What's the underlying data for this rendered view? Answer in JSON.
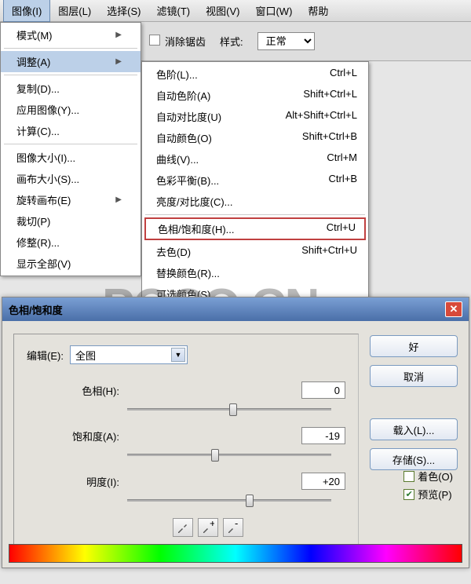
{
  "menubar": {
    "items": [
      {
        "label": "图像(I)",
        "hot": "I",
        "active": true
      },
      {
        "label": "图层(L)"
      },
      {
        "label": "选择(S)"
      },
      {
        "label": "滤镜(T)"
      },
      {
        "label": "视图(V)"
      },
      {
        "label": "窗口(W)"
      },
      {
        "label": "帮助"
      }
    ]
  },
  "optionsbar": {
    "antialias": "消除锯齿",
    "style_label": "样式:",
    "style_value": "正常"
  },
  "image_menu": {
    "items": [
      {
        "label": "模式(M)",
        "arrow": true
      },
      {
        "sep": true
      },
      {
        "label": "调整(A)",
        "arrow": true,
        "hl": true
      },
      {
        "sep": true
      },
      {
        "label": "复制(D)..."
      },
      {
        "label": "应用图像(Y)..."
      },
      {
        "label": "计算(C)..."
      },
      {
        "sep": true
      },
      {
        "label": "图像大小(I)..."
      },
      {
        "label": "画布大小(S)..."
      },
      {
        "label": "旋转画布(E)",
        "arrow": true
      },
      {
        "label": "裁切(P)"
      },
      {
        "label": "修整(R)..."
      },
      {
        "label": "显示全部(V)"
      }
    ]
  },
  "adjust_submenu": {
    "items": [
      {
        "label": "色阶(L)...",
        "sc": "Ctrl+L"
      },
      {
        "label": "自动色阶(A)",
        "sc": "Shift+Ctrl+L"
      },
      {
        "label": "自动对比度(U)",
        "sc": "Alt+Shift+Ctrl+L"
      },
      {
        "label": "自动颜色(O)",
        "sc": "Shift+Ctrl+B"
      },
      {
        "label": "曲线(V)...",
        "sc": "Ctrl+M"
      },
      {
        "label": "色彩平衡(B)...",
        "sc": "Ctrl+B"
      },
      {
        "label": "亮度/对比度(C)...",
        "sc": ""
      },
      {
        "sep": true
      },
      {
        "label": "色相/饱和度(H)...",
        "sc": "Ctrl+U",
        "boxed": true
      },
      {
        "label": "去色(D)",
        "sc": "Shift+Ctrl+U"
      },
      {
        "label": "替换颜色(R)...",
        "sc": ""
      },
      {
        "label": "可选颜色(S)...",
        "sc": ""
      }
    ]
  },
  "watermark": "POCO.CN",
  "dialog": {
    "title": "色相/饱和度",
    "edit_label": "编辑(E):",
    "edit_value": "全图",
    "sliders": {
      "hue": {
        "label": "色相(H):",
        "value": "0",
        "pos": 50
      },
      "sat": {
        "label": "饱和度(A):",
        "value": "-19",
        "pos": 41
      },
      "light": {
        "label": "明度(I):",
        "value": "+20",
        "pos": 58
      }
    },
    "buttons": {
      "ok": "好",
      "cancel": "取消",
      "load": "载入(L)...",
      "save": "存储(S)..."
    },
    "colorize": "着色(O)",
    "preview": "预览(P)"
  }
}
